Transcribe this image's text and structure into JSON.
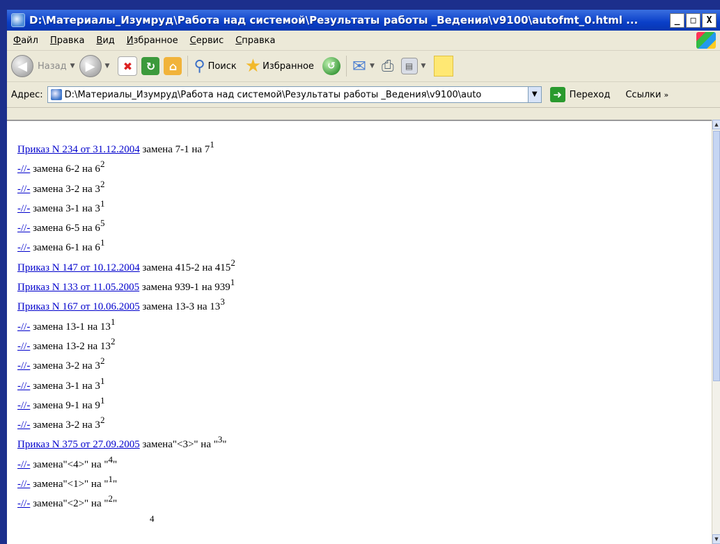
{
  "window": {
    "title": "D:\\Материалы_Изумруд\\Работа над системой\\Результаты работы _Ведения\\v9100\\autofmt_0.html ...",
    "controls": {
      "minimize": "_",
      "maximize": "□",
      "close": "X"
    }
  },
  "menu": {
    "items": [
      "Файл",
      "Правка",
      "Вид",
      "Избранное",
      "Сервис",
      "Справка"
    ]
  },
  "toolbar": {
    "back_label": "Назад",
    "search_label": "Поиск",
    "favorites_label": "Избранное"
  },
  "address": {
    "label": "Адрес:",
    "value": "D:\\Материалы_Изумруд\\Работа над системой\\Результаты работы _Ведения\\v9100\\auto",
    "go_label": "Переход",
    "links_label": "Ссылки"
  },
  "document": {
    "lines": [
      {
        "link": "Приказ N 234 от 31.12.2004",
        "text": " замена 7-1 на 7",
        "sup": "1"
      },
      {
        "link": "-//-",
        "text": " замена 6-2 на 6",
        "sup": "2"
      },
      {
        "link": "-//-",
        "text": " замена 3-2 на 3",
        "sup": "2"
      },
      {
        "link": "-//-",
        "text": " замена 3-1 на 3",
        "sup": "1"
      },
      {
        "link": "-//-",
        "text": " замена 6-5 на 6",
        "sup": "5"
      },
      {
        "link": "-//-",
        "text": " замена 6-1 на 6",
        "sup": "1"
      },
      {
        "link": "Приказ N 147 от 10.12.2004",
        "text": " замена 415-2 на 415",
        "sup": "2"
      },
      {
        "link": "Приказ N 133 от 11.05.2005",
        "text": " замена 939-1 на 939",
        "sup": "1"
      },
      {
        "link": "Приказ N 167 от 10.06.2005",
        "text": " замена 13-3 на 13",
        "sup": "3"
      },
      {
        "link": "-//-",
        "text": " замена 13-1 на 13",
        "sup": "1"
      },
      {
        "link": "-//-",
        "text": " замена 13-2 на 13",
        "sup": "2"
      },
      {
        "link": "-//-",
        "text": " замена 3-2 на 3",
        "sup": "2"
      },
      {
        "link": "-//-",
        "text": " замена 3-1 на 3",
        "sup": "1"
      },
      {
        "link": "-//-",
        "text": " замена 9-1 на 9",
        "sup": "1"
      },
      {
        "link": "-//-",
        "text": " замена 3-2 на 3",
        "sup": "2"
      },
      {
        "link": "Приказ N 375 от 27.09.2005",
        "text": " замена\"<3>\" на \"",
        "sup": "3",
        "tail": "\""
      },
      {
        "link": "-//-",
        "text": " замена\"<4>\" на \"",
        "sup": "4",
        "tail": "\""
      },
      {
        "link": "-//-",
        "text": " замена\"<1>\" на \"",
        "sup": "1",
        "tail": "\""
      },
      {
        "link": "-//-",
        "text": " замена\"<2>\" на \"",
        "sup": "2",
        "tail": "\""
      },
      {
        "link": "",
        "text": "",
        "sup": "4"
      }
    ]
  }
}
